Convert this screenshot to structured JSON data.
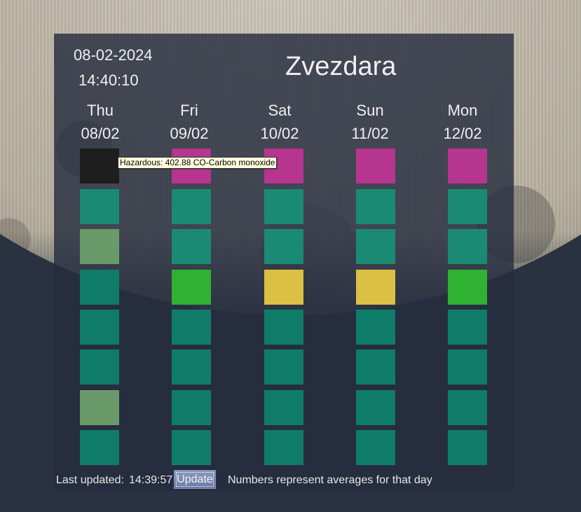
{
  "header": {
    "date": "08-02-2024",
    "time": "14:40:10",
    "station": "Zvezdara"
  },
  "days": [
    {
      "weekday": "Thu",
      "date": "08/02"
    },
    {
      "weekday": "Fri",
      "date": "09/02"
    },
    {
      "weekday": "Sat",
      "date": "10/02"
    },
    {
      "weekday": "Sun",
      "date": "11/02"
    },
    {
      "weekday": "Mon",
      "date": "12/02"
    }
  ],
  "palette": {
    "hazardous_black": "#1e1e1e",
    "very_unhealthy_magenta": "#b5358f",
    "good_teal": "#0f7c6a",
    "teal_light": "#1a8a75",
    "sage_green": "#6a9a69",
    "moderate_green": "#2fb232",
    "yellow": "#dcc043"
  },
  "grid": [
    [
      "#1e1e1e",
      "#b5358f",
      "#b5358f",
      "#b5358f",
      "#b5358f"
    ],
    [
      "#1a8a75",
      "#1a8a75",
      "#1a8a75",
      "#1a8a75",
      "#1a8a75"
    ],
    [
      "#6a9a69",
      "#1a8a75",
      "#1a8a75",
      "#1a8a75",
      "#1a8a75"
    ],
    [
      "#0f7c6a",
      "#2fb232",
      "#dcc043",
      "#dcc043",
      "#2fb232"
    ],
    [
      "#0f7c6a",
      "#0f7c6a",
      "#0f7c6a",
      "#0f7c6a",
      "#0f7c6a"
    ],
    [
      "#0f7c6a",
      "#0f7c6a",
      "#0f7c6a",
      "#0f7c6a",
      "#0f7c6a"
    ],
    [
      "#6a9a69",
      "#0f7c6a",
      "#0f7c6a",
      "#0f7c6a",
      "#0f7c6a"
    ],
    [
      "#0f7c6a",
      "#0f7c6a",
      "#0f7c6a",
      "#0f7c6a",
      "#0f7c6a"
    ]
  ],
  "tooltip": {
    "text": "Hazardous: 402.88 CO-Carbon monoxide"
  },
  "footer": {
    "last_updated_label": "Last updated:",
    "last_updated_time": "14:39:57",
    "update_button": "Update",
    "note": "Numbers represent averages for that day"
  }
}
